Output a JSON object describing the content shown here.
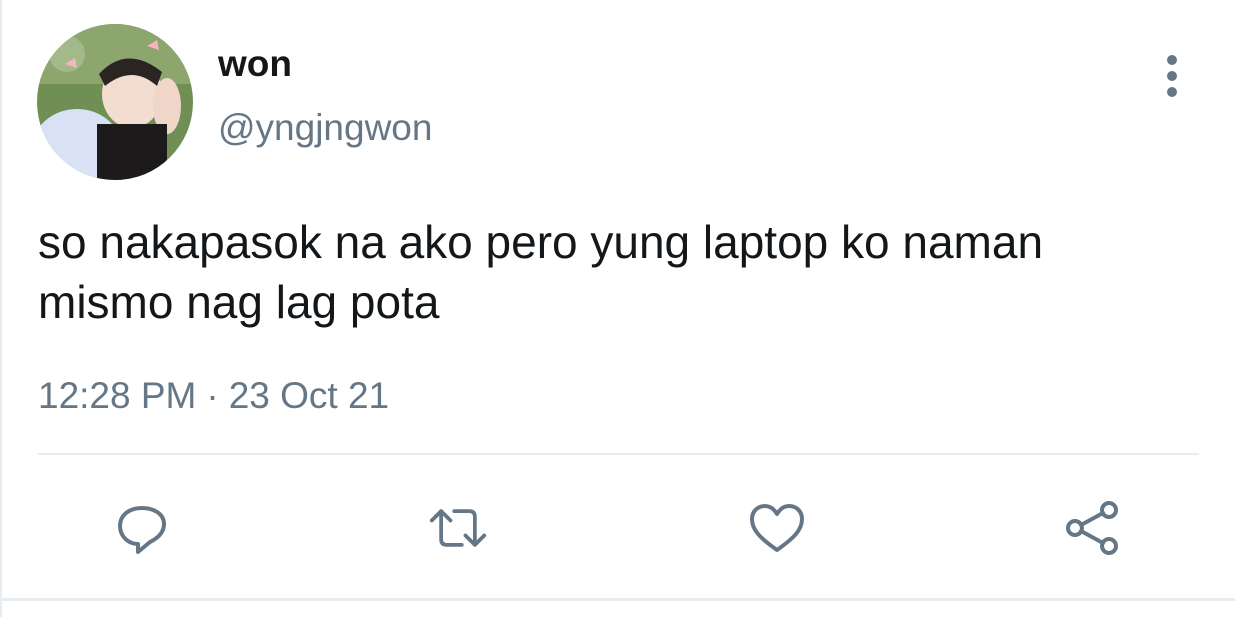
{
  "tweet": {
    "author": {
      "display_name": "won",
      "handle": "@yngjngwon"
    },
    "text": "so nakapasok na ako pero yung laptop ko naman mismo nag lag pota",
    "time": "12:28 PM",
    "separator": "·",
    "date": "23 Oct 21"
  },
  "icons": {
    "avatar": "avatar-photo",
    "more": "more-vertical-icon",
    "reply": "reply-icon",
    "retweet": "retweet-icon",
    "like": "like-icon",
    "share": "share-icon"
  },
  "colors": {
    "text_primary": "#14171a",
    "text_secondary": "#657786",
    "icon": "#657786",
    "divider": "#e6ecf0"
  }
}
